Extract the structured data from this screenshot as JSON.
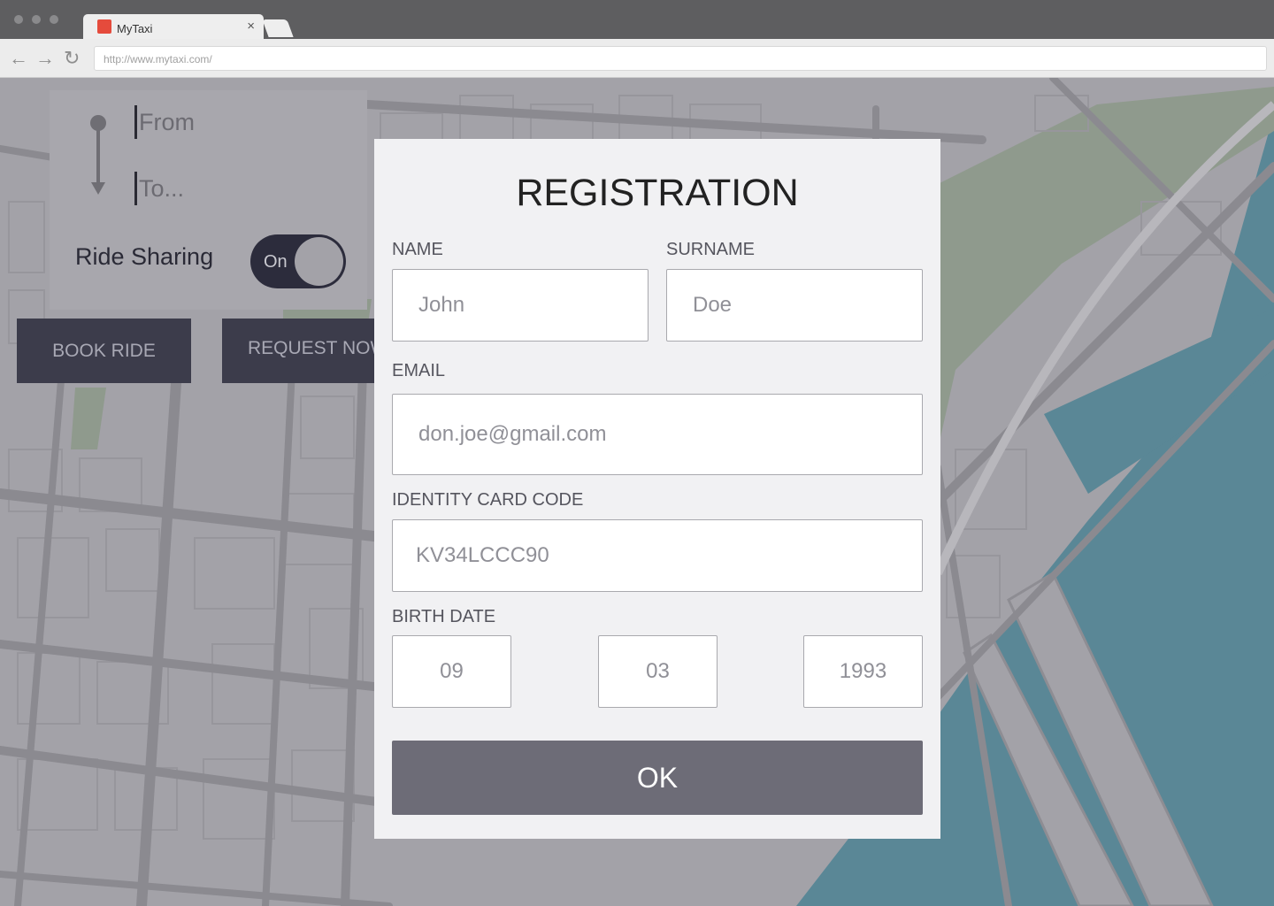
{
  "browser": {
    "tab_title": "MyTaxi",
    "tab_close": "×",
    "url": "http://www.mytaxi.com/",
    "back_glyph": "←",
    "forward_glyph": "→",
    "reload_glyph": "↻"
  },
  "route": {
    "from_placeholder": "From",
    "to_placeholder": "To..."
  },
  "ride_sharing": {
    "label": "Ride Sharing",
    "toggle_text": "On"
  },
  "actions": {
    "book_ride": "BOOK RIDE",
    "request_now": "REQUEST NOW"
  },
  "registration": {
    "title": "REGISTRATION",
    "name_label": "NAME",
    "name_placeholder": "John",
    "surname_label": "SURNAME",
    "surname_placeholder": "Doe",
    "email_label": "EMAIL",
    "email_placeholder": "don.joe@gmail.com",
    "id_label": "IDENTITY CARD CODE",
    "id_placeholder": "KV34LCCC90",
    "birth_label": "BIRTH DATE",
    "birth_day": "09",
    "birth_month": "03",
    "birth_year": "1993",
    "ok_label": "OK"
  },
  "colors": {
    "map_background": "#a3a2a8",
    "map_water": "#5a8796",
    "map_park": "#8f9a8d",
    "button_dark": "#3c3c4b",
    "ok_button": "#6d6c77",
    "favicon": "#e54b3c"
  }
}
